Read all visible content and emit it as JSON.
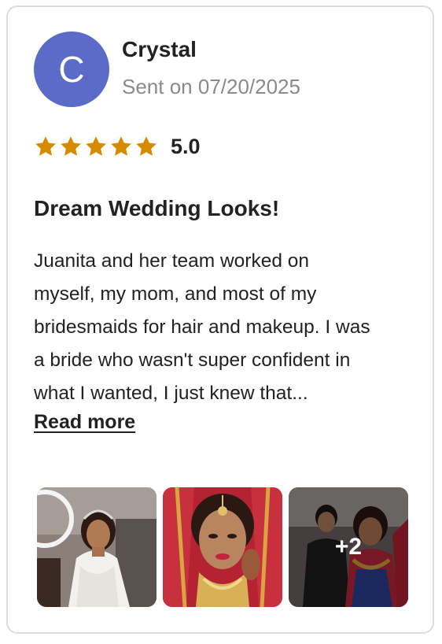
{
  "reviewer": {
    "initial": "C",
    "name": "Crystal",
    "sent_label": "Sent on 07/20/2025",
    "avatar_color": "#5c6bc7"
  },
  "rating": {
    "stars": 5,
    "max": 5,
    "value_label": "5.0",
    "star_color": "#d68a00"
  },
  "review": {
    "title": "Dream Wedding Looks!",
    "lines": [
      "Juanita and her team worked on",
      "myself, my mom, and most of my",
      "bridesmaids for hair and makeup. I was",
      "a bride who wasn't super confident in",
      "what I wanted, I just knew that..."
    ],
    "read_more_label": "Read more"
  },
  "photos": {
    "items": [
      {
        "icon": "bride-white-dress-photo"
      },
      {
        "icon": "bride-closeup-jewelry-photo"
      },
      {
        "icon": "bride-with-artist-photo",
        "overlay": "+2"
      }
    ]
  }
}
